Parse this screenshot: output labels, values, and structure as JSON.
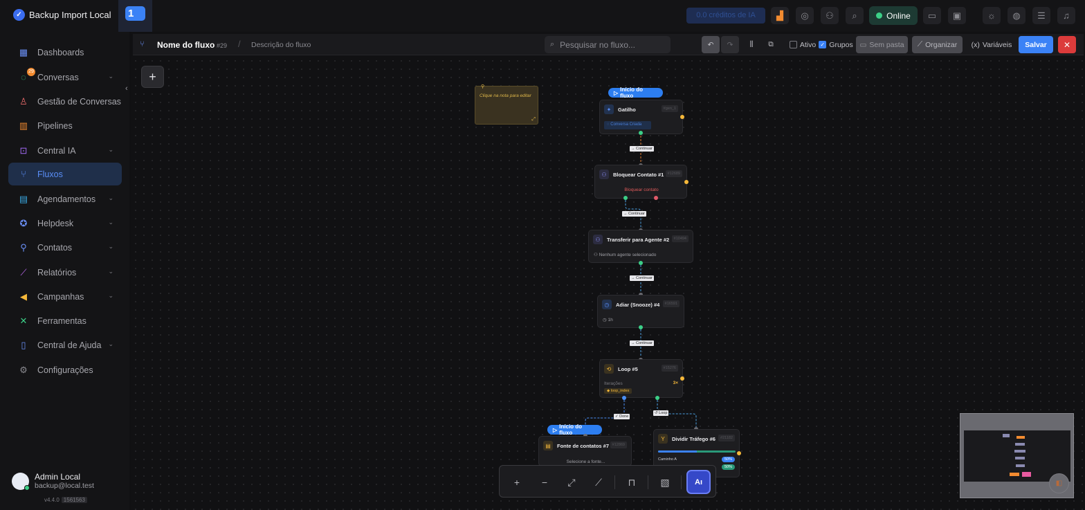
{
  "app": {
    "title": "Backup Import Local",
    "tab_number": "1",
    "ai_credits": "0.0 créditos de IA",
    "status": "Online"
  },
  "sidebar": {
    "items": [
      {
        "label": "Dashboards",
        "icon": "dashboard-icon"
      },
      {
        "label": "Conversas",
        "icon": "chat-icon",
        "badge": "29",
        "expandable": true
      },
      {
        "label": "Gestão de Conversas",
        "icon": "conversation-management-icon"
      },
      {
        "label": "Pipelines",
        "icon": "pipeline-icon"
      },
      {
        "label": "Central IA",
        "icon": "ai-icon",
        "expandable": true
      },
      {
        "label": "Fluxos",
        "icon": "flow-icon",
        "active": true
      },
      {
        "label": "Agendamentos",
        "icon": "calendar-icon",
        "expandable": true
      },
      {
        "label": "Helpdesk",
        "icon": "helpdesk-icon",
        "expandable": true
      },
      {
        "label": "Contatos",
        "icon": "contacts-icon",
        "expandable": true
      },
      {
        "label": "Relatórios",
        "icon": "reports-icon",
        "expandable": true
      },
      {
        "label": "Campanhas",
        "icon": "megaphone-icon",
        "expandable": true
      },
      {
        "label": "Ferramentas",
        "icon": "tools-icon"
      },
      {
        "label": "Central de Ajuda",
        "icon": "book-icon",
        "expandable": true
      },
      {
        "label": "Configurações",
        "icon": "gear-icon"
      }
    ],
    "user": {
      "name": "Admin Local",
      "email": "backup@local.test"
    },
    "version": "v4.4.0",
    "build": "1561563"
  },
  "flow": {
    "name": "Nome do fluxo",
    "id": "#29",
    "description": "Descrição do fluxo",
    "search_placeholder": "Pesquisar no fluxo...",
    "active_label": "Ativo",
    "active": false,
    "groups_label": "Grupos",
    "groups": true,
    "folder_label": "Sem pasta",
    "organize_label": "Organizar",
    "variables_label": "Variáveis",
    "save_label": "Salvar"
  },
  "canvas": {
    "note_text": "Clique na nota para editar",
    "start_label": "Início do fluxo",
    "edge_continue": "→ Continuar",
    "edge_done": "✓ Done",
    "edge_loop": "↺ Loop",
    "nodes": {
      "trigger": {
        "title": "Gatilho",
        "id": "#gen_1",
        "body": "Conversa Criada"
      },
      "block": {
        "title": "Bloquear Contato #1",
        "id": "#12689",
        "body": "Bloquear contato"
      },
      "transfer": {
        "title": "Transferir para Agente #2",
        "id": "#10494",
        "body": "Nenhum agente selecionado"
      },
      "snooze": {
        "title": "Adiar (Snooze) #4",
        "id": "#16591",
        "body": "1h"
      },
      "loop": {
        "title": "Loop #5",
        "id": "#15276",
        "body_label": "Iterações",
        "body_value": "3×",
        "tag": "loop_index"
      },
      "source": {
        "title": "Fonte de contatos #7",
        "id": "#12869",
        "body": "Selecione a fonte..."
      },
      "split": {
        "title": "Dividir Tráfego #6",
        "id": "#21182",
        "path_a": "Caminho A",
        "pct_a": "50%",
        "pct_b": "50%",
        "split_a": 0.5
      }
    }
  },
  "colors": {
    "accent": "#3b82f6",
    "danger": "#dc3b3b",
    "success": "#3ccf87",
    "warning": "#f5b83a"
  }
}
